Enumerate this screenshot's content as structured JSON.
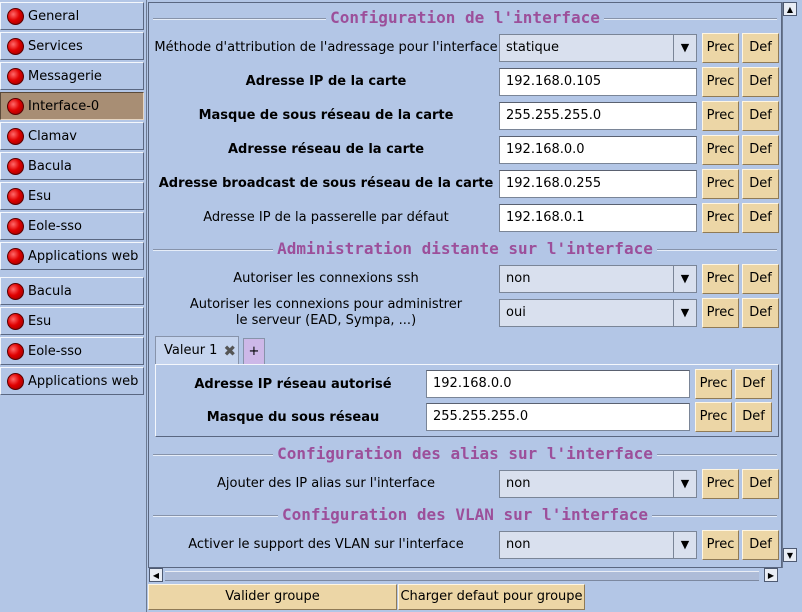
{
  "sidebar": {
    "items": [
      {
        "label": "General"
      },
      {
        "label": "Services"
      },
      {
        "label": "Messagerie"
      },
      {
        "label": "Interface-0",
        "active": true
      },
      {
        "label": "Clamav"
      },
      {
        "label": "Bacula"
      },
      {
        "label": "Esu"
      },
      {
        "label": "Eole-sso"
      },
      {
        "label": "Applications web"
      },
      {
        "label": "Bacula"
      },
      {
        "label": "Esu"
      },
      {
        "label": "Eole-sso"
      },
      {
        "label": "Applications web"
      }
    ]
  },
  "buttons": {
    "prec": "Prec",
    "def": "Def"
  },
  "sections": {
    "interface": {
      "title": "Configuration de l'interface",
      "rows": [
        {
          "label": "Méthode d'attribution de l'adressage pour l'interface",
          "value": "statique",
          "type": "select"
        },
        {
          "label": "Adresse IP de la carte",
          "value": "192.168.0.105"
        },
        {
          "label": "Masque de sous réseau de la carte",
          "value": "255.255.255.0"
        },
        {
          "label": "Adresse réseau de la carte",
          "value": "192.168.0.0"
        },
        {
          "label": "Adresse broadcast de sous réseau de la carte",
          "value": "192.168.0.255"
        },
        {
          "label": "Adresse IP de la passerelle par défaut",
          "value": "192.168.0.1"
        }
      ]
    },
    "remote": {
      "title": "Administration distante sur l'interface",
      "ssh": {
        "label": "Autoriser les connexions ssh",
        "value": "non"
      },
      "admin": {
        "label_line1": "Autoriser les connexions pour administrer",
        "label_line2": "le serveur (EAD, Sympa, ...)",
        "value": "oui"
      },
      "tab": {
        "label": "Valeur 1",
        "add": "+"
      },
      "network": {
        "label": "Adresse IP réseau autorisé",
        "value": "192.168.0.0"
      },
      "mask": {
        "label": "Masque du sous réseau",
        "value": "255.255.255.0"
      }
    },
    "alias": {
      "title": "Configuration des alias sur l'interface",
      "row": {
        "label": "Ajouter des IP alias sur l'interface",
        "value": "non"
      }
    },
    "vlan": {
      "title": "Configuration des VLAN sur l'interface",
      "row": {
        "label": "Activer le support des VLAN sur l'interface",
        "value": "non"
      }
    }
  },
  "footer": {
    "validate": "Valider groupe",
    "load_default": "Charger defaut pour groupe"
  }
}
